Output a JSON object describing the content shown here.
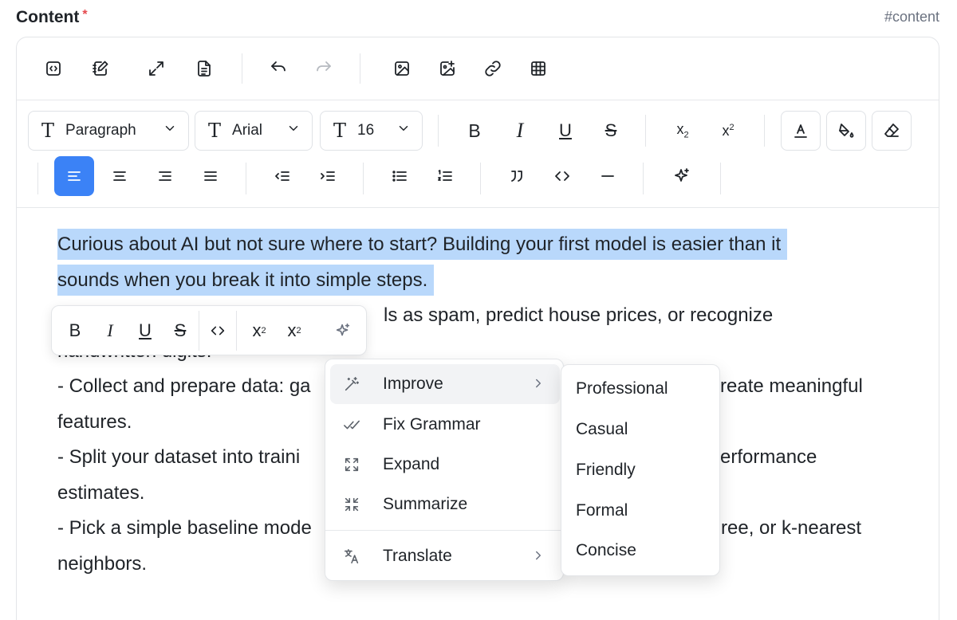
{
  "field": {
    "label": "Content",
    "required_mark": "*",
    "id_hint": "#content"
  },
  "toolbar_top": {
    "icons": [
      "source-code-icon",
      "edit-document-icon",
      "fullscreen-icon",
      "preview-document-icon",
      "undo-icon",
      "redo-icon",
      "image-icon",
      "add-image-icon",
      "link-icon",
      "table-icon"
    ]
  },
  "toolbar_format": {
    "block_type": "Paragraph",
    "font_family": "Arial",
    "font_size": "16",
    "text_type_glyph": "T",
    "bold_glyph": "B",
    "italic_glyph": "I",
    "underline_glyph": "U",
    "strike_glyph": "S",
    "subscript_glyph": "x",
    "subscript_sub": "2",
    "superscript_glyph": "x",
    "superscript_sup": "2",
    "active_alignment": "left"
  },
  "content": {
    "highlighted_line1": "Curious about AI but not sure where to start? Building your first model is easier than it",
    "highlighted_line2": "sounds when you break it into simple steps.",
    "line3_visible": "ls as spam, predict house prices, or recognize",
    "line4": "handwritten digits.",
    "line5_left": "- Collect and prepare data: ga",
    "line5_right": "reate meaningful",
    "line6": "features.",
    "line7_left": "- Split your dataset into traini",
    "line7_right": "erformance",
    "line8": "estimates.",
    "line9_left": "- Pick a simple baseline mode",
    "line9_right": "ree, or k-nearest",
    "line10": "neighbors."
  },
  "bubble_menu": {
    "bold": "B",
    "italic": "I",
    "underline": "U",
    "strike": "S",
    "sub_base": "x",
    "sub_num": "2",
    "sup_base": "x",
    "sup_num": "2"
  },
  "ai_menu": {
    "items": [
      {
        "label": "Improve",
        "icon": "magic-wand-icon",
        "has_submenu": true
      },
      {
        "label": "Fix Grammar",
        "icon": "double-check-icon",
        "has_submenu": false
      },
      {
        "label": "Expand",
        "icon": "expand-arrows-icon",
        "has_submenu": false
      },
      {
        "label": "Summarize",
        "icon": "collapse-arrows-icon",
        "has_submenu": false
      },
      {
        "label": "Translate",
        "icon": "translate-icon",
        "has_submenu": true
      }
    ],
    "hovered": "Improve"
  },
  "improve_submenu": {
    "items": [
      "Professional",
      "Casual",
      "Friendly",
      "Formal",
      "Concise"
    ]
  }
}
